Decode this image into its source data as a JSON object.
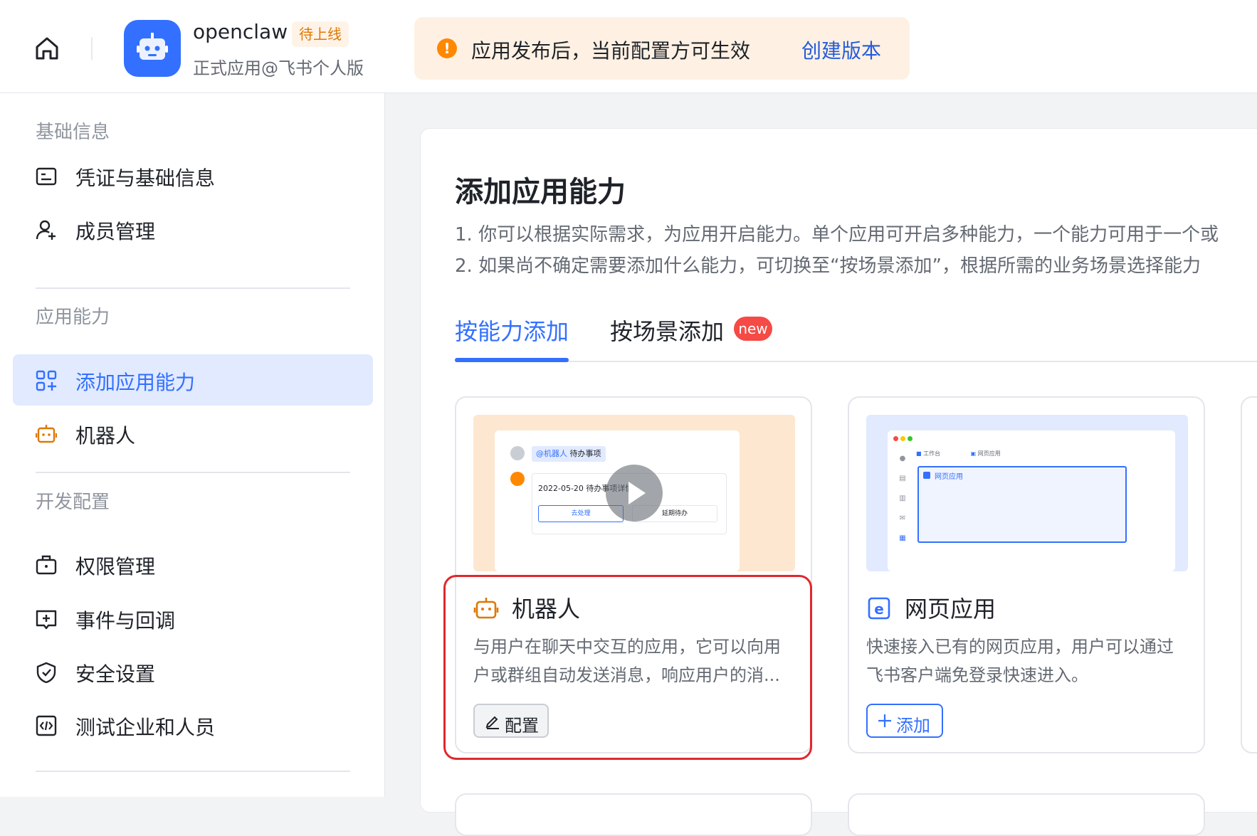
{
  "header": {
    "app_name": "openclaw",
    "app_badge": "待上线",
    "app_subtitle": "正式应用@飞书个人版",
    "notice_text": "应用发布后，当前配置方可生效",
    "notice_link": "创建版本"
  },
  "sidebar": {
    "sections": [
      {
        "title": "基础信息",
        "items": [
          {
            "label": "凭证与基础信息"
          },
          {
            "label": "成员管理"
          }
        ]
      },
      {
        "title": "应用能力",
        "items": [
          {
            "label": "添加应用能力"
          },
          {
            "label": "机器人"
          }
        ]
      },
      {
        "title": "开发配置",
        "items": [
          {
            "label": "权限管理"
          },
          {
            "label": "事件与回调"
          },
          {
            "label": "安全设置"
          },
          {
            "label": "测试企业和人员"
          }
        ]
      }
    ],
    "active_item": "添加应用能力"
  },
  "main": {
    "title": "添加应用能力",
    "desc1": "1. 你可以根据实际需求，为应用开启能力。单个应用可开启多种能力，一个能力可用于一个或",
    "desc2": "2. 如果尚不确定需要添加什么能力，可切换至“按场景添加”，根据所需的业务场景选择能力",
    "tabs": [
      {
        "label": "按能力添加"
      },
      {
        "label": "按场景添加"
      }
    ],
    "new_badge": "new",
    "cards": [
      {
        "title": "机器人",
        "desc": "与用户在聊天中交互的应用，它可以向用户或群组自动发送消息，响应用户的消...",
        "button": "配置",
        "preview": {
          "mention": "@机器人",
          "mention_text": "待办事项",
          "message": "2022-05-20 待办事项详情",
          "action1": "去处理",
          "action2": "延期待办"
        }
      },
      {
        "title": "网页应用",
        "desc": "快速接入已有的网页应用，用户可以通过飞书客户端免登录快速进入。",
        "button": "添加",
        "preview": {
          "tab1": "工作台",
          "tab2": "网页应用",
          "window_label": "网页应用"
        }
      }
    ]
  },
  "colors": {
    "accent": "#3370ff",
    "warning": "#ff8800",
    "highlight": "#e0282e",
    "robot": "#de7802"
  }
}
